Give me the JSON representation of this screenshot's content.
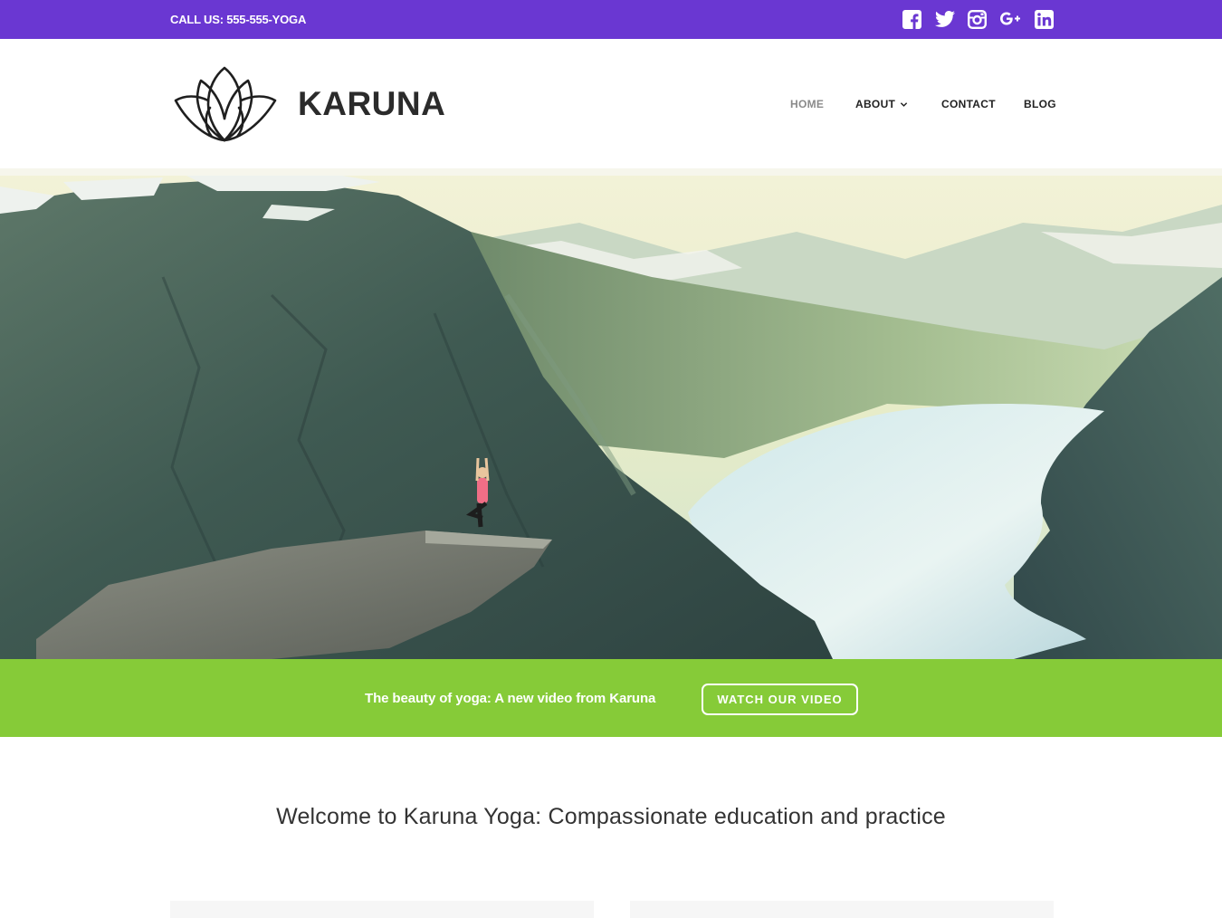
{
  "topbar": {
    "phone_text": "CALL US: 555-555-YOGA",
    "color": "#6a37d2",
    "social": [
      "facebook-icon",
      "twitter-icon",
      "instagram-icon",
      "google-plus-icon",
      "linkedin-icon"
    ]
  },
  "header": {
    "brand": "KARUNA",
    "nav": [
      {
        "label": "HOME",
        "active": true
      },
      {
        "label": "ABOUT",
        "has_dropdown": true
      },
      {
        "label": "CONTACT"
      },
      {
        "label": "BLOG"
      }
    ]
  },
  "cta": {
    "message": "The beauty of yoga: A new video from Karuna",
    "button_label": "WATCH OUR VIDEO",
    "color": "#86cb38"
  },
  "welcome": {
    "heading": "Welcome to Karuna Yoga: Compassionate education and practice"
  }
}
